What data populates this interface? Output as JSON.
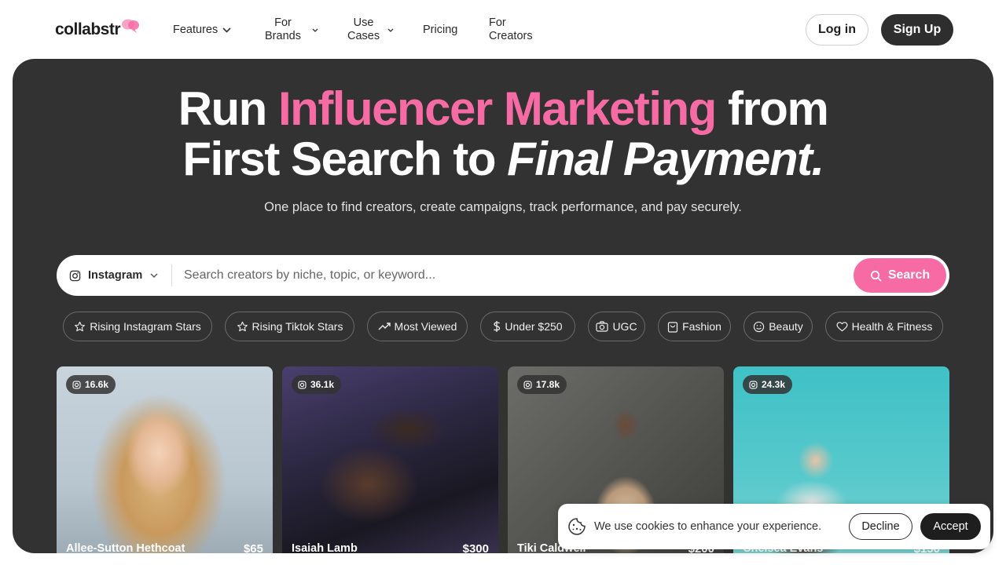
{
  "nav": {
    "logo": "collabstr",
    "items": [
      {
        "label": "Features"
      },
      {
        "label_line1": "For",
        "label_line2": "Brands"
      },
      {
        "label_line1": "Use",
        "label_line2": "Cases"
      },
      {
        "label": "Pricing"
      },
      {
        "label_line1": "For",
        "label_line2": "Creators"
      }
    ],
    "login": "Log in",
    "signup": "Sign Up"
  },
  "hero": {
    "title_l1_a": "Run ",
    "title_l1_b": "Influencer Marketing",
    "title_l1_c": " from",
    "title_l2_a": "First Search to ",
    "title_l2_b": "Final Payment.",
    "subtitle": "One place to find creators, create campaigns, track performance, and pay securely."
  },
  "search": {
    "platform": "Instagram",
    "placeholder": "Search creators by niche, topic, or keyword...",
    "button": "Search"
  },
  "chips": [
    {
      "label": "Rising Instagram Stars",
      "icon": "star-icon"
    },
    {
      "label": "Rising Tiktok Stars",
      "icon": "star-icon"
    },
    {
      "label": "Most Viewed",
      "icon": "trending-up-icon"
    },
    {
      "label": "Under $250",
      "icon": "dollar-icon"
    },
    {
      "label": "UGC",
      "icon": "camera-icon"
    },
    {
      "label": "Fashion",
      "icon": "bag-icon"
    },
    {
      "label": "Beauty",
      "icon": "smile-icon"
    },
    {
      "label": "Health & Fitness",
      "icon": "heart-icon"
    }
  ],
  "creators": [
    {
      "followers": "16.6k",
      "name": "Allee-Sutton Hethcoat",
      "price": "$65"
    },
    {
      "followers": "36.1k",
      "name": "Isaiah Lamb",
      "price": "$300"
    },
    {
      "followers": "17.8k",
      "name": "Tiki Caldwell",
      "price": "$200"
    },
    {
      "followers": "24.3k",
      "name": "Chelsea Evans",
      "price": "$150"
    }
  ],
  "cookie": {
    "message": "We use cookies to enhance your experience.",
    "decline": "Decline",
    "accept": "Accept"
  },
  "colors": {
    "accent": "#f76ba4",
    "hero_bg": "#323232",
    "dark_button": "#2e2e2e"
  }
}
